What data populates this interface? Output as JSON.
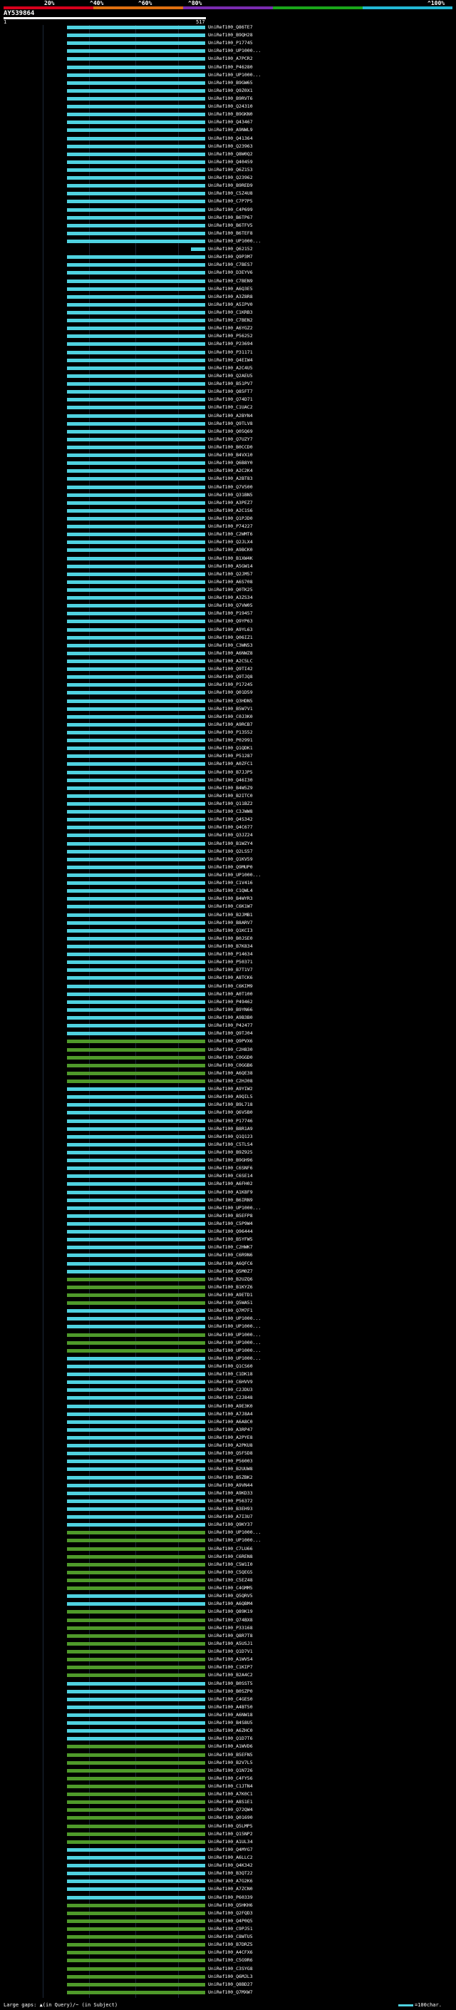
{
  "header": {
    "ticks": [
      "20%",
      "^40%",
      "^60%",
      "^80%",
      "^100%"
    ],
    "colorbar": [
      "#d6001c",
      "#e07010",
      "#7a2bb0",
      "#1aa61a",
      "#22b8d4"
    ],
    "query_title": "AY539864",
    "scale_start": "1",
    "scale_end": "517"
  },
  "legend": {
    "gaps_label": "Large gaps: ▲(in Query)/~ (in Subject)",
    "scale_label": "=100char."
  },
  "colors": {
    "cyan": "#4fd2e0",
    "green": "#4f9a2a",
    "gap": "#ffe400"
  },
  "hits": [
    {
      "label": "UniRef100_Q86TE7",
      "color": "cyan"
    },
    {
      "label": "UniRef100_B9QH28",
      "color": "cyan"
    },
    {
      "label": "UniRef100_P17745",
      "color": "cyan"
    },
    {
      "label": "UniRef100_UP1000...",
      "color": "cyan"
    },
    {
      "label": "UniRef100_A7PCR2",
      "color": "cyan"
    },
    {
      "label": "UniRef100_P46280",
      "color": "cyan"
    },
    {
      "label": "UniRef100_UP1000...",
      "color": "cyan"
    },
    {
      "label": "UniRef100_B9GW65",
      "color": "cyan"
    },
    {
      "label": "UniRef100_Q9Z0X1",
      "color": "cyan"
    },
    {
      "label": "UniRef100_B9RVT6",
      "color": "cyan"
    },
    {
      "label": "UniRef100_Q24310",
      "color": "cyan"
    },
    {
      "label": "UniRef100_B9GKN0",
      "color": "cyan"
    },
    {
      "label": "UniRef100_Q43467",
      "color": "cyan"
    },
    {
      "label": "UniRef100_A9NWL9",
      "color": "cyan"
    },
    {
      "label": "UniRef100_Q41364",
      "color": "cyan"
    },
    {
      "label": "UniRef100_Q23963",
      "color": "cyan"
    },
    {
      "label": "UniRef100_Q8W0Q2",
      "color": "cyan"
    },
    {
      "label": "UniRef100_Q40459",
      "color": "cyan"
    },
    {
      "label": "UniRef100_Q6Z153",
      "color": "cyan"
    },
    {
      "label": "UniRef100_Q23962",
      "color": "cyan"
    },
    {
      "label": "UniRef100_B9RED9",
      "color": "cyan"
    },
    {
      "label": "UniRef100_C5Z4U8",
      "color": "cyan"
    },
    {
      "label": "UniRef100_C7P7P5",
      "color": "cyan"
    },
    {
      "label": "UniRef100_C4P699",
      "color": "cyan"
    },
    {
      "label": "UniRef100_B6TP67",
      "color": "cyan"
    },
    {
      "label": "UniRef100_B6TFV5",
      "color": "cyan"
    },
    {
      "label": "UniRef100_B6TEF8",
      "color": "cyan"
    },
    {
      "label": "UniRef100_UP1000...",
      "color": "cyan"
    },
    {
      "label": "UniRef100_Q62152",
      "color": "cyan"
    },
    {
      "label": "UniRef100_Q9P3M7",
      "color": "cyan"
    },
    {
      "label": "UniRef100_C7BES7",
      "color": "cyan"
    },
    {
      "label": "UniRef100_D3EYV6",
      "color": "cyan"
    },
    {
      "label": "UniRef100_C7BEN9",
      "color": "cyan"
    },
    {
      "label": "UniRef100_A6Q3E5",
      "color": "cyan"
    },
    {
      "label": "UniRef100_A3Z8R8",
      "color": "cyan"
    },
    {
      "label": "UniRef100_A5IPV0",
      "color": "cyan"
    },
    {
      "label": "UniRef100_C1KRB3",
      "color": "cyan"
    },
    {
      "label": "UniRef100_C7BEN2",
      "color": "cyan"
    },
    {
      "label": "UniRef100_A6YGZ2",
      "color": "cyan"
    },
    {
      "label": "UniRef100_P56252",
      "color": "cyan"
    },
    {
      "label": "UniRef100_P23694",
      "color": "cyan"
    },
    {
      "label": "UniRef100_P31171",
      "color": "cyan"
    },
    {
      "label": "UniRef100_Q4EIW4",
      "color": "cyan"
    },
    {
      "label": "UniRef100_A2C4U5",
      "color": "cyan"
    },
    {
      "label": "UniRef100_Q2AEU5",
      "color": "cyan"
    },
    {
      "label": "UniRef100_B51PV7",
      "color": "cyan"
    },
    {
      "label": "UniRef100_Q85FT7",
      "color": "cyan"
    },
    {
      "label": "UniRef100_Q74D71",
      "color": "cyan"
    },
    {
      "label": "UniRef100_C1UAC2",
      "color": "cyan"
    },
    {
      "label": "UniRef100_A2BYN4",
      "color": "cyan"
    },
    {
      "label": "UniRef100_Q9TLV8",
      "color": "cyan"
    },
    {
      "label": "UniRef100_Q05Q69",
      "color": "cyan"
    },
    {
      "label": "UniRef100_Q7UZY7",
      "color": "cyan"
    },
    {
      "label": "UniRef100_B0CCD0",
      "color": "cyan"
    },
    {
      "label": "UniRef100_B4VX10",
      "color": "cyan"
    },
    {
      "label": "UniRef100_Q6B8Y0",
      "color": "cyan"
    },
    {
      "label": "UniRef100_A2C2K4",
      "color": "cyan"
    },
    {
      "label": "UniRef100_A2BT83",
      "color": "cyan"
    },
    {
      "label": "UniRef100_Q7V500",
      "color": "cyan"
    },
    {
      "label": "UniRef100_Q31BN5",
      "color": "cyan"
    },
    {
      "label": "UniRef100_A3PEZ7",
      "color": "cyan"
    },
    {
      "label": "UniRef100_A2C1S6",
      "color": "cyan"
    },
    {
      "label": "UniRef100_Q1PJD0",
      "color": "cyan"
    },
    {
      "label": "UniRef100_P74227",
      "color": "cyan"
    },
    {
      "label": "UniRef100_C2WMT6",
      "color": "cyan"
    },
    {
      "label": "UniRef100_Q2JLX4",
      "color": "cyan"
    },
    {
      "label": "UniRef100_A9BCK0",
      "color": "cyan"
    },
    {
      "label": "UniRef100_B1XW4K",
      "color": "cyan"
    },
    {
      "label": "UniRef100_A5GW14",
      "color": "cyan"
    },
    {
      "label": "UniRef100_Q2JM57",
      "color": "cyan"
    },
    {
      "label": "UniRef100_A6S708",
      "color": "cyan"
    },
    {
      "label": "UniRef100_Q0TK25",
      "color": "cyan"
    },
    {
      "label": "UniRef100_A3ZS34",
      "color": "cyan"
    },
    {
      "label": "UniRef100_Q7VW05",
      "color": "cyan"
    },
    {
      "label": "UniRef100_P19457",
      "color": "cyan"
    },
    {
      "label": "UniRef100_Q9YP63",
      "color": "cyan"
    },
    {
      "label": "UniRef100_A9YL63",
      "color": "cyan"
    },
    {
      "label": "UniRef100_Q06IZ1",
      "color": "cyan"
    },
    {
      "label": "UniRef100_C3WN53",
      "color": "cyan"
    },
    {
      "label": "UniRef100_A6NWZ8",
      "color": "cyan"
    },
    {
      "label": "UniRef100_A2C5LC",
      "color": "cyan"
    },
    {
      "label": "UniRef100_Q9TI42",
      "color": "cyan"
    },
    {
      "label": "UniRef100_Q9TJQ8",
      "color": "cyan"
    },
    {
      "label": "UniRef100_P17245",
      "color": "cyan"
    },
    {
      "label": "UniRef100_Q01D59",
      "color": "cyan"
    },
    {
      "label": "UniRef100_Q3HDN5",
      "color": "cyan"
    },
    {
      "label": "UniRef100_B5W7V1",
      "color": "cyan"
    },
    {
      "label": "UniRef100_C0J3K0",
      "color": "cyan"
    },
    {
      "label": "UniRef100_A9RCB7",
      "color": "cyan"
    },
    {
      "label": "UniRef100_P13552",
      "color": "cyan"
    },
    {
      "label": "UniRef100_P02991",
      "color": "cyan"
    },
    {
      "label": "UniRef100_Q1QDK1",
      "color": "cyan"
    },
    {
      "label": "UniRef100_P51287",
      "color": "cyan"
    },
    {
      "label": "UniRef100_A0ZFC1",
      "color": "cyan"
    },
    {
      "label": "UniRef100_B7JJP5",
      "color": "cyan"
    },
    {
      "label": "UniRef100_Q46I30",
      "color": "cyan"
    },
    {
      "label": "UniRef100_B4W5Z9",
      "color": "cyan"
    },
    {
      "label": "UniRef100_B2ITC0",
      "color": "cyan"
    },
    {
      "label": "UniRef100_Q11BZ2",
      "color": "cyan"
    },
    {
      "label": "UniRef100_C3JWW8",
      "color": "cyan"
    },
    {
      "label": "UniRef100_Q4S342",
      "color": "cyan"
    },
    {
      "label": "UniRef100_Q4C677",
      "color": "cyan"
    },
    {
      "label": "UniRef100_Q3JZ24",
      "color": "cyan"
    },
    {
      "label": "UniRef100_B1WZY4",
      "color": "cyan"
    },
    {
      "label": "UniRef100_Q2LS57",
      "color": "cyan"
    },
    {
      "label": "UniRef100_Q1KV59",
      "color": "cyan"
    },
    {
      "label": "UniRef100_Q9MUP0",
      "color": "cyan"
    },
    {
      "label": "UniRef100_UP1000...",
      "color": "cyan"
    },
    {
      "label": "UniRef100_C1V416",
      "color": "cyan"
    },
    {
      "label": "UniRef100_C1QWL4",
      "color": "cyan"
    },
    {
      "label": "UniRef100_B4WYR3",
      "color": "cyan"
    },
    {
      "label": "UniRef100_C6K1W7",
      "color": "cyan"
    },
    {
      "label": "UniRef100_B2JMB1",
      "color": "cyan"
    },
    {
      "label": "UniRef100_B8ARV7",
      "color": "cyan"
    },
    {
      "label": "UniRef100_Q1KCI3",
      "color": "cyan"
    },
    {
      "label": "UniRef100_B0JSE0",
      "color": "cyan"
    },
    {
      "label": "UniRef100_B7K834",
      "color": "cyan"
    },
    {
      "label": "UniRef100_P14634",
      "color": "cyan"
    },
    {
      "label": "UniRef100_P50371",
      "color": "cyan"
    },
    {
      "label": "UniRef100_B7T1V7",
      "color": "cyan"
    },
    {
      "label": "UniRef100_A8TCK6",
      "color": "cyan"
    },
    {
      "label": "UniRef100_C6KIM9",
      "color": "cyan"
    },
    {
      "label": "UniRef100_A0T100",
      "color": "cyan"
    },
    {
      "label": "UniRef100_P49462",
      "color": "cyan"
    },
    {
      "label": "UniRef100_B9YN66",
      "color": "cyan"
    },
    {
      "label": "UniRef100_A9B3B0",
      "color": "cyan"
    },
    {
      "label": "UniRef100_P42477",
      "color": "cyan"
    },
    {
      "label": "UniRef100_Q9TJ04",
      "color": "cyan"
    },
    {
      "label": "UniRef100_Q9PVX6",
      "color": "green"
    },
    {
      "label": "UniRef100_C2H830",
      "color": "green"
    },
    {
      "label": "UniRef100_C0GGD0",
      "color": "green"
    },
    {
      "label": "UniRef100_C0GGB6",
      "color": "green"
    },
    {
      "label": "UniRef100_A6QE38",
      "color": "green"
    },
    {
      "label": "UniRef100_C2HJ08",
      "color": "green"
    },
    {
      "label": "UniRef100_A9YIW2",
      "color": "cyan"
    },
    {
      "label": "UniRef100_A9QIL5",
      "color": "cyan"
    },
    {
      "label": "UniRef100_B9L718",
      "color": "cyan"
    },
    {
      "label": "UniRef100_Q6V5B0",
      "color": "cyan"
    },
    {
      "label": "UniRef100_P17746",
      "color": "cyan"
    },
    {
      "label": "UniRef100_B8R1A9",
      "color": "cyan"
    },
    {
      "label": "UniRef100_Q1Q123",
      "color": "cyan"
    },
    {
      "label": "UniRef100_C5TLS4",
      "color": "cyan"
    },
    {
      "label": "UniRef100_B9Z925",
      "color": "cyan"
    },
    {
      "label": "UniRef100_B9GH96",
      "color": "cyan"
    },
    {
      "label": "UniRef100_C6SNF6",
      "color": "cyan"
    },
    {
      "label": "UniRef100_C6SE14",
      "color": "cyan"
    },
    {
      "label": "UniRef100_A6FH02",
      "color": "cyan"
    },
    {
      "label": "UniRef100_A1K8F9",
      "color": "cyan"
    },
    {
      "label": "UniRef100_B6IRN9",
      "color": "cyan"
    },
    {
      "label": "UniRef100_UP1000...",
      "color": "cyan"
    },
    {
      "label": "UniRef100_B5EFP8",
      "color": "cyan"
    },
    {
      "label": "UniRef100_C5P9W4",
      "color": "cyan"
    },
    {
      "label": "UniRef100_Q96444",
      "color": "cyan"
    },
    {
      "label": "UniRef100_B5YFW5",
      "color": "cyan"
    },
    {
      "label": "UniRef100_C2HWK7",
      "color": "cyan"
    },
    {
      "label": "UniRef100_C6R9N6",
      "color": "cyan"
    },
    {
      "label": "UniRef100_A6QFC6",
      "color": "cyan"
    },
    {
      "label": "UniRef100_Q5M0Z7",
      "color": "cyan"
    },
    {
      "label": "UniRef100_B2UZQ6",
      "color": "green"
    },
    {
      "label": "UniRef100_B1KYZ6",
      "color": "green"
    },
    {
      "label": "UniRef100_A9ETD1",
      "color": "green"
    },
    {
      "label": "UniRef100_Q5WA51",
      "color": "green"
    },
    {
      "label": "UniRef100_Q7M7F1",
      "color": "cyan"
    },
    {
      "label": "UniRef100_UP1000...",
      "color": "cyan"
    },
    {
      "label": "UniRef100_UP1000...",
      "color": "cyan"
    },
    {
      "label": "UniRef100_UP1000...",
      "color": "green"
    },
    {
      "label": "UniRef100_UP1000...",
      "color": "green"
    },
    {
      "label": "UniRef100_UP1000...",
      "color": "green"
    },
    {
      "label": "UniRef100_UP1000...",
      "color": "cyan"
    },
    {
      "label": "UniRef100_Q1CS60",
      "color": "cyan"
    },
    {
      "label": "UniRef100_C1DK18",
      "color": "cyan"
    },
    {
      "label": "UniRef100_C6HVV9",
      "color": "cyan"
    },
    {
      "label": "UniRef100_C2JDU3",
      "color": "cyan"
    },
    {
      "label": "UniRef100_C2J848",
      "color": "cyan"
    },
    {
      "label": "UniRef100_A9E3K0",
      "color": "cyan"
    },
    {
      "label": "UniRef100_A7J8A4",
      "color": "cyan"
    },
    {
      "label": "UniRef100_A6A8C0",
      "color": "cyan"
    },
    {
      "label": "UniRef100_A3RP47",
      "color": "cyan"
    },
    {
      "label": "UniRef100_A2PYE8",
      "color": "cyan"
    },
    {
      "label": "UniRef100_A2PKU8",
      "color": "cyan"
    },
    {
      "label": "UniRef100_Q5F5D8",
      "color": "cyan"
    },
    {
      "label": "UniRef100_P56003",
      "color": "cyan"
    },
    {
      "label": "UniRef100_B2UUW8",
      "color": "cyan"
    },
    {
      "label": "UniRef100_B5ZBK2",
      "color": "cyan"
    },
    {
      "label": "UniRef100_A9VN44",
      "color": "cyan"
    },
    {
      "label": "UniRef100_A9KD33",
      "color": "cyan"
    },
    {
      "label": "UniRef100_P56372",
      "color": "cyan"
    },
    {
      "label": "UniRef100_B3EH93",
      "color": "cyan"
    },
    {
      "label": "UniRef100_A7I3U7",
      "color": "cyan"
    },
    {
      "label": "UniRef100_Q9KY37",
      "color": "cyan"
    },
    {
      "label": "UniRef100_UP1000...",
      "color": "green"
    },
    {
      "label": "UniRef100_UP1000...",
      "color": "green"
    },
    {
      "label": "UniRef100_C7LU66",
      "color": "green"
    },
    {
      "label": "UniRef100_C6REN8",
      "color": "green"
    },
    {
      "label": "UniRef100_C5W1I0",
      "color": "green"
    },
    {
      "label": "UniRef100_C5QEG5",
      "color": "green"
    },
    {
      "label": "UniRef100_C5EZ48",
      "color": "green"
    },
    {
      "label": "UniRef100_C4GMM5",
      "color": "green"
    },
    {
      "label": "UniRef100_Q5QRV5",
      "color": "cyan"
    },
    {
      "label": "UniRef100_A6QBM4",
      "color": "cyan"
    },
    {
      "label": "UniRef100_Q89K19",
      "color": "green"
    },
    {
      "label": "UniRef100_Q74BX8",
      "color": "green"
    },
    {
      "label": "UniRef100_P33168",
      "color": "green"
    },
    {
      "label": "UniRef100_Q8R7T8",
      "color": "green"
    },
    {
      "label": "UniRef100_A5USJ1",
      "color": "green"
    },
    {
      "label": "UniRef100_Q1D7V1",
      "color": "green"
    },
    {
      "label": "UniRef100_A1WVS4",
      "color": "green"
    },
    {
      "label": "UniRef100_C1KIP7",
      "color": "green"
    },
    {
      "label": "UniRef100_B2A4C2",
      "color": "green"
    },
    {
      "label": "UniRef100_B0SST5",
      "color": "cyan"
    },
    {
      "label": "UniRef100_B0SZP0",
      "color": "cyan"
    },
    {
      "label": "UniRef100_C4GES0",
      "color": "cyan"
    },
    {
      "label": "UniRef100_A4BT50",
      "color": "cyan"
    },
    {
      "label": "UniRef100_A6NW18",
      "color": "cyan"
    },
    {
      "label": "UniRef100_B4S8U5",
      "color": "cyan"
    },
    {
      "label": "UniRef100_A6ZHC0",
      "color": "cyan"
    },
    {
      "label": "UniRef100_Q1D7T6",
      "color": "cyan"
    },
    {
      "label": "UniRef100_A1WVD6",
      "color": "green"
    },
    {
      "label": "UniRef100_B5EFN5",
      "color": "green"
    },
    {
      "label": "UniRef100_B2V7L5",
      "color": "green"
    },
    {
      "label": "UniRef100_Q1N726",
      "color": "green"
    },
    {
      "label": "UniRef100_C4FY56",
      "color": "green"
    },
    {
      "label": "UniRef100_C1JTN4",
      "color": "green"
    },
    {
      "label": "UniRef100_A7K0C1",
      "color": "green"
    },
    {
      "label": "UniRef100_A8S1E1",
      "color": "green"
    },
    {
      "label": "UniRef100_Q72QW4",
      "color": "green"
    },
    {
      "label": "UniRef100_Q01690",
      "color": "green"
    },
    {
      "label": "UniRef100_Q5LMP5",
      "color": "green"
    },
    {
      "label": "UniRef100_Q15NP2",
      "color": "green"
    },
    {
      "label": "UniRef100_A1UL34",
      "color": "green"
    },
    {
      "label": "UniRef100_Q4MYG7",
      "color": "cyan"
    },
    {
      "label": "UniRef100_A6LLC2",
      "color": "cyan"
    },
    {
      "label": "UniRef100_Q4K342",
      "color": "cyan"
    },
    {
      "label": "UniRef100_B3QT22",
      "color": "cyan"
    },
    {
      "label": "UniRef100_A7G2K6",
      "color": "cyan"
    },
    {
      "label": "UniRef100_A7ZCN0",
      "color": "cyan"
    },
    {
      "label": "UniRef100_P60339",
      "color": "cyan"
    },
    {
      "label": "UniRef100_Q5HKH6",
      "color": "green"
    },
    {
      "label": "UniRef100_Q2FQD3",
      "color": "green"
    },
    {
      "label": "UniRef100_Q4P0Q5",
      "color": "green"
    },
    {
      "label": "UniRef100_C9PJ51",
      "color": "green"
    },
    {
      "label": "UniRef100_C8WTU5",
      "color": "green"
    },
    {
      "label": "UniRef100_B7DRZ5",
      "color": "green"
    },
    {
      "label": "UniRef100_A4CFX6",
      "color": "green"
    },
    {
      "label": "UniRef100_C5G9R6",
      "color": "green"
    },
    {
      "label": "UniRef100_C3SYG8",
      "color": "green"
    },
    {
      "label": "UniRef100_Q6MJL3",
      "color": "green"
    },
    {
      "label": "UniRef100_Q8BD27",
      "color": "green"
    },
    {
      "label": "UniRef100_Q7MXW7",
      "color": "green"
    }
  ]
}
